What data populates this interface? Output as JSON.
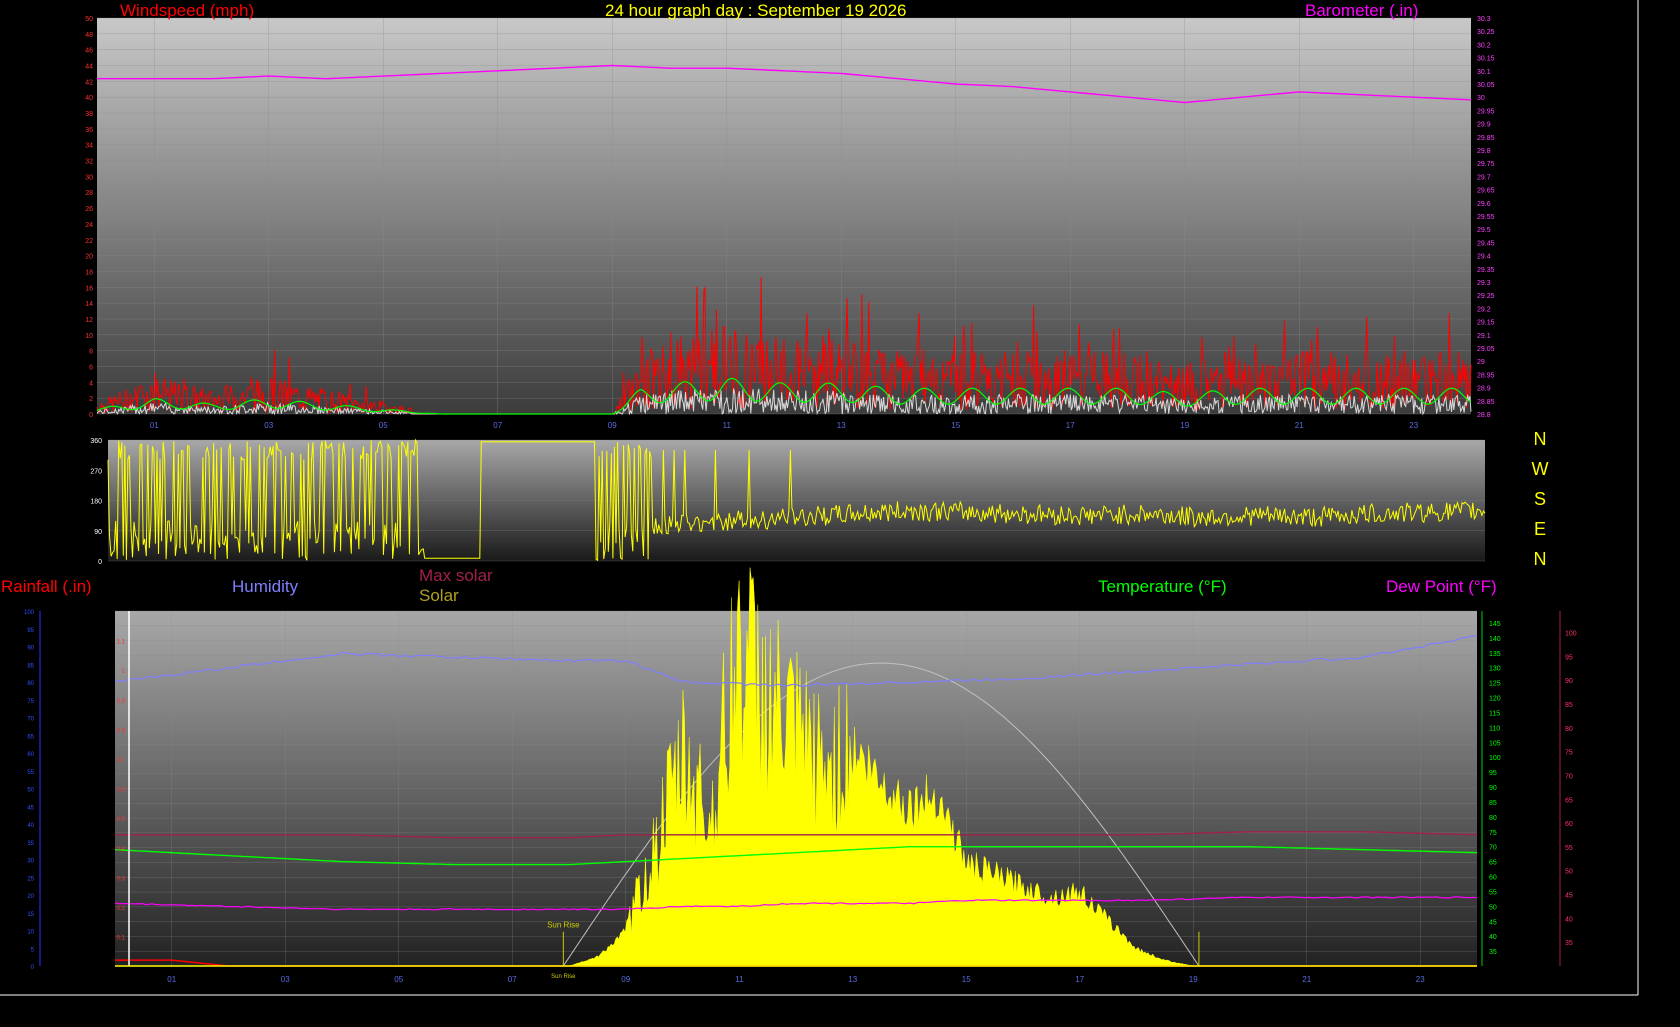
{
  "top_chart": {
    "title": "24 hour graph day : September 19 2026",
    "left_label": "Windspeed (mph)",
    "right_label": "Barometer (.in)",
    "x_ticks": [
      "01",
      "03",
      "05",
      "07",
      "09",
      "11",
      "13",
      "15",
      "17",
      "19",
      "21",
      "23"
    ],
    "wind_ticks": [
      "50",
      "48",
      "46",
      "44",
      "42",
      "40",
      "38",
      "36",
      "34",
      "32",
      "30",
      "28",
      "26",
      "24",
      "22",
      "20",
      "18",
      "16",
      "14",
      "12",
      "10",
      "8",
      "6",
      "4",
      "2",
      "0"
    ],
    "baro_ticks": [
      "30.3",
      "30.25",
      "30.2",
      "30.15",
      "30.1",
      "30.05",
      "30",
      "29.95",
      "29.9",
      "29.85",
      "29.8",
      "29.75",
      "29.7",
      "29.65",
      "29.6",
      "29.55",
      "29.5",
      "29.45",
      "29.4",
      "29.35",
      "29.3",
      "29.25",
      "29.2",
      "29.15",
      "29.1",
      "29.05",
      "29",
      "28.95",
      "28.9",
      "28.85",
      "28.8"
    ]
  },
  "wind_dir_chart": {
    "y_ticks": [
      "360",
      "270",
      "180",
      "90",
      "0"
    ],
    "compass": [
      "N",
      "W",
      "S",
      "E",
      "N"
    ]
  },
  "bottom_chart": {
    "rainfall_label": "Rainfall (.in)",
    "humidity_label": "Humidity",
    "max_solar_label": "Max solar",
    "solar_label": "Solar",
    "temperature_label": "Temperature (°F)",
    "dewpoint_label": "Dew Point (°F)",
    "sunrise_label": "Sun Rise",
    "x_ticks": [
      "01",
      "03",
      "05",
      "07",
      "09",
      "11",
      "13",
      "15",
      "17",
      "19",
      "21",
      "23"
    ],
    "rain_ticks": [
      "1.1",
      "1",
      "0.9",
      "0.8",
      "0.7",
      "0.6",
      "0.5",
      "0.4",
      "0.3",
      "0.2",
      "0.1"
    ],
    "temp_ticks": [
      "145",
      "140",
      "135",
      "130",
      "125",
      "120",
      "115",
      "110",
      "105",
      "100",
      "95",
      "90",
      "85",
      "80",
      "75",
      "70",
      "65",
      "60",
      "55",
      "50",
      "45",
      "40",
      "35"
    ],
    "dew_ticks": [
      "100",
      "95",
      "90",
      "85",
      "80",
      "75",
      "70",
      "65",
      "60",
      "55",
      "50",
      "45",
      "40",
      "35"
    ]
  },
  "colors": {
    "wind": "#ff0000",
    "wind_avg": "#00ff00",
    "wind_low": "#ffffff",
    "barometer": "#ff00ff",
    "direction": "#ffff00",
    "humidity": "#7f7fff",
    "max_solar": "#c0c0c0",
    "solar": "#ffff00",
    "temperature": "#00ff00",
    "dewpoint": "#ff00ff",
    "rain": "#ff0000",
    "solar_max_line": "#c0c0c0",
    "title": "#ffff00"
  },
  "chart_data": [
    {
      "type": "line",
      "title": "24 hour graph day : September 19 2026",
      "xlabel": "",
      "ylabel": "Windspeed (mph)",
      "y2label": "Barometer (.in)",
      "xlim": [
        0,
        24
      ],
      "ylim": [
        0,
        50
      ],
      "y2lim": [
        28.8,
        30.3
      ],
      "series": [
        {
          "name": "Windspeed (mph)",
          "axis": "left",
          "x": [
            0,
            1,
            2,
            3,
            4,
            5,
            6,
            7,
            8,
            9,
            9.5,
            10,
            11,
            12,
            13,
            14,
            15,
            16,
            17,
            18,
            19,
            20,
            21,
            22,
            23,
            24
          ],
          "values": [
            1,
            3,
            2,
            3,
            2,
            1,
            0,
            0,
            0,
            0,
            5,
            6,
            7,
            6,
            6,
            5,
            5,
            5,
            5,
            5,
            4,
            5,
            5,
            5,
            5,
            5
          ]
        },
        {
          "name": "Barometer (.in)",
          "axis": "right",
          "x": [
            0,
            1,
            2,
            3,
            4,
            5,
            6,
            7,
            8,
            9,
            10,
            11,
            12,
            13,
            14,
            15,
            16,
            17,
            18,
            19,
            20,
            21,
            22,
            23,
            24
          ],
          "values": [
            30.07,
            30.07,
            30.07,
            30.08,
            30.07,
            30.08,
            30.09,
            30.1,
            30.11,
            30.12,
            30.11,
            30.11,
            30.1,
            30.09,
            30.07,
            30.05,
            30.04,
            30.02,
            30.0,
            29.98,
            30.0,
            30.02,
            30.01,
            30.0,
            29.99
          ]
        }
      ]
    },
    {
      "type": "line",
      "xlabel": "",
      "ylabel": "",
      "xlim": [
        0,
        24
      ],
      "ylim": [
        0,
        360
      ],
      "series": [
        {
          "name": "Wind direction",
          "x": [
            0,
            1,
            2,
            3,
            4,
            5,
            6,
            7,
            8,
            9,
            10,
            11,
            12,
            13,
            14,
            15,
            16,
            17,
            18,
            19,
            20,
            21,
            22,
            23,
            24
          ],
          "values": [
            90,
            300,
            80,
            320,
            340,
            200,
            20,
            360,
            330,
            100,
            110,
            120,
            130,
            140,
            150,
            145,
            140,
            135,
            140,
            130,
            135,
            130,
            140,
            145,
            150
          ]
        }
      ]
    },
    {
      "type": "area",
      "xlabel": "",
      "xlim": [
        0,
        24
      ],
      "series": [
        {
          "name": "Humidity",
          "x": [
            0,
            2,
            4,
            6,
            8,
            9,
            10,
            12,
            14,
            16,
            18,
            20,
            22,
            24
          ],
          "values": [
            0.8,
            0.84,
            0.88,
            0.87,
            0.86,
            0.86,
            0.8,
            0.79,
            0.8,
            0.81,
            0.83,
            0.85,
            0.87,
            0.93
          ]
        },
        {
          "name": "Temperature (°F)",
          "x": [
            0,
            2,
            4,
            6,
            8,
            9,
            10,
            11,
            12,
            13,
            14,
            15,
            16,
            17,
            18,
            20,
            22,
            24
          ],
          "values": [
            69,
            67,
            65,
            64,
            64,
            65,
            66,
            67,
            68,
            69,
            70,
            70,
            70,
            70,
            70,
            70,
            69,
            68
          ]
        },
        {
          "name": "Dew Point (°F)",
          "x": [
            0,
            2,
            4,
            6,
            8,
            9,
            10,
            11,
            12,
            13,
            14,
            15,
            16,
            17,
            18,
            20,
            22,
            24
          ],
          "values": [
            51,
            50,
            49,
            49,
            49,
            49,
            50,
            50,
            51,
            51,
            51,
            52,
            52,
            52,
            52,
            53,
            53,
            53
          ]
        },
        {
          "name": "Max solar",
          "x": [
            0,
            2,
            4,
            6,
            8,
            9,
            10,
            11,
            12,
            13,
            14,
            15,
            16,
            17,
            18,
            20,
            22,
            24
          ],
          "values": [
            74,
            74,
            74,
            73,
            73,
            74,
            74,
            74,
            74,
            74,
            74,
            74,
            74,
            74,
            74,
            75,
            75,
            74
          ]
        },
        {
          "name": "Solar",
          "x": [
            8,
            8.5,
            9,
            9.5,
            10,
            10.5,
            11,
            11.5,
            12,
            12.5,
            13,
            13.5,
            14,
            14.5,
            15,
            15.5,
            16,
            16.5,
            17,
            17.5,
            18,
            18.5,
            19
          ],
          "values": [
            0,
            8,
            30,
            100,
            180,
            130,
            280,
            230,
            200,
            170,
            190,
            160,
            140,
            150,
            90,
            80,
            70,
            60,
            65,
            40,
            15,
            5,
            0
          ]
        },
        {
          "name": "Rainfall (.in)",
          "x": [
            0,
            1,
            2,
            24
          ],
          "values": [
            0.02,
            0.02,
            0,
            0
          ]
        }
      ]
    }
  ]
}
